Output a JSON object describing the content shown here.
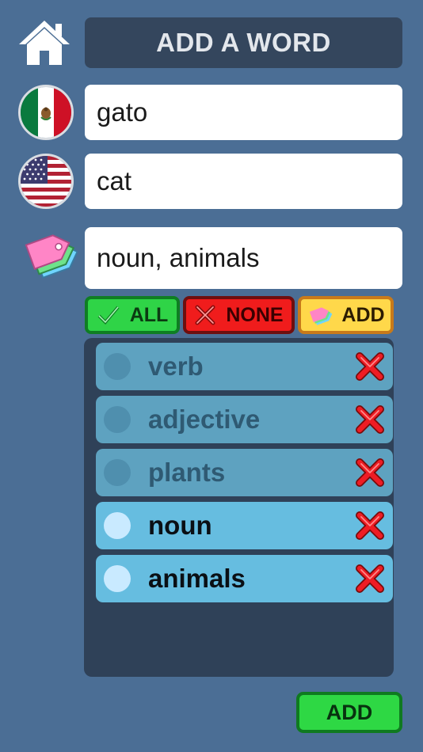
{
  "header": {
    "title": "ADD A WORD"
  },
  "fields": {
    "source_word": "gato",
    "target_word": "cat",
    "tags": "noun, animals"
  },
  "filters": {
    "all_label": "ALL",
    "none_label": "NONE",
    "add_label": "ADD"
  },
  "tag_list": [
    {
      "label": "verb",
      "selected": false
    },
    {
      "label": "adjective",
      "selected": false
    },
    {
      "label": "plants",
      "selected": false
    },
    {
      "label": "noun",
      "selected": true
    },
    {
      "label": "animals",
      "selected": true
    }
  ],
  "footer": {
    "add_label": "ADD"
  },
  "icons": {
    "home": "home-icon",
    "source_flag": "mexico-flag-icon",
    "target_flag": "usa-flag-icon",
    "tags": "tags-icon",
    "check": "check-icon",
    "cross": "cross-icon",
    "delete": "delete-icon"
  },
  "colors": {
    "background": "#4b6e95",
    "title_bar": "#34465d",
    "green": "#2fd447",
    "red": "#f01c1c",
    "yellow": "#ffd84a",
    "tag_selected": "#66bde0",
    "tag_unselected": "#5ea2c0"
  }
}
